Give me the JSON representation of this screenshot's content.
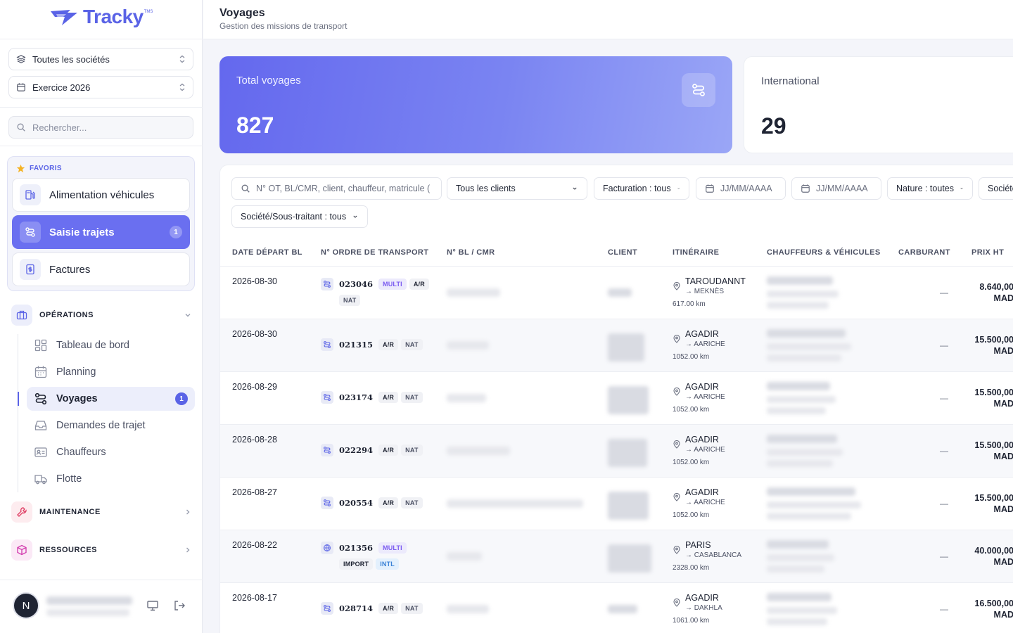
{
  "brand": {
    "name": "Tracky",
    "suffix": "TMS"
  },
  "sidebar": {
    "company_select": "Toutes les sociétés",
    "year_select": "Exercice 2026",
    "search_placeholder": "Rechercher...",
    "favorites": {
      "title": "FAVORIS",
      "items": [
        {
          "label": "Alimentation véhicules"
        },
        {
          "label": "Saisie trajets",
          "badge": "1"
        },
        {
          "label": "Factures"
        }
      ]
    },
    "sections": {
      "operations": "OPÉRATIONS",
      "maintenance": "MAINTENANCE",
      "ressources": "RESSOURCES"
    },
    "nav": [
      {
        "label": "Tableau de bord"
      },
      {
        "label": "Planning"
      },
      {
        "label": "Voyages",
        "badge": "1"
      },
      {
        "label": "Demandes de trajet"
      },
      {
        "label": "Chauffeurs"
      },
      {
        "label": "Flotte"
      }
    ],
    "user_initial": "N"
  },
  "header": {
    "title": "Voyages",
    "subtitle": "Gestion des missions de transport"
  },
  "stats": {
    "total": {
      "label": "Total voyages",
      "value": "827"
    },
    "international": {
      "label": "International",
      "value": "29"
    }
  },
  "filters": {
    "search_placeholder": "N° OT, BL/CMR, client, chauffeur, matricule (",
    "clients": "Tous les clients",
    "facturation": "Facturation : tous",
    "date_from": "JJ/MM/AAAA",
    "date_to": "JJ/MM/AAAA",
    "nature": "Nature : toutes",
    "societe": "Société",
    "sous_traitant": "Société/Sous-traitant : tous"
  },
  "table": {
    "columns": [
      "DATE DÉPART BL",
      "N° ORDRE DE TRANSPORT",
      "N° BL / CMR",
      "CLIENT",
      "ITINÉRAIRE",
      "CHAUFFEURS & VÉHICULES",
      "CARBURANT",
      "PRIX HT"
    ],
    "rows": [
      {
        "date": "2026-08-30",
        "ot": "023046",
        "tags1": [
          "MULTI",
          "A/R"
        ],
        "tags2": [
          "NAT"
        ],
        "from": "TAROUDANNT",
        "to": "→ MEKNÈS",
        "km": "617.00 km",
        "fuel": "—",
        "price": "8.640,00",
        "currency": "MAD"
      },
      {
        "date": "2026-08-30",
        "ot": "021315",
        "tags1": [
          "A/R",
          "NAT"
        ],
        "tags2": [],
        "from": "AGADIR",
        "to": "→ AARICHE",
        "km": "1052.00 km",
        "fuel": "—",
        "price": "15.500,00",
        "currency": "MAD"
      },
      {
        "date": "2026-08-29",
        "ot": "023174",
        "tags1": [
          "A/R",
          "NAT"
        ],
        "tags2": [],
        "from": "AGADIR",
        "to": "→ AARICHE",
        "km": "1052.00 km",
        "fuel": "—",
        "price": "15.500,00",
        "currency": "MAD"
      },
      {
        "date": "2026-08-28",
        "ot": "022294",
        "tags1": [
          "A/R",
          "NAT"
        ],
        "tags2": [],
        "from": "AGADIR",
        "to": "→ AARICHE",
        "km": "1052.00 km",
        "fuel": "—",
        "price": "15.500,00",
        "currency": "MAD"
      },
      {
        "date": "2026-08-27",
        "ot": "020554",
        "tags1": [
          "A/R",
          "NAT"
        ],
        "tags2": [],
        "from": "AGADIR",
        "to": "→ AARICHE",
        "km": "1052.00 km",
        "fuel": "—",
        "price": "15.500,00",
        "currency": "MAD"
      },
      {
        "date": "2026-08-22",
        "ot": "021356",
        "tags1": [
          "MULTI"
        ],
        "tags2": [
          "IMPORT",
          "INTL"
        ],
        "from": "PARIS",
        "to": "→ CASABLANCA",
        "km": "2328.00 km",
        "fuel": "—",
        "price": "40.000,00",
        "currency": "MAD"
      },
      {
        "date": "2026-08-17",
        "ot": "028714",
        "tags1": [
          "A/R",
          "NAT"
        ],
        "tags2": [],
        "from": "AGADIR",
        "to": "→ DAKHLA",
        "km": "1061.00 km",
        "fuel": "—",
        "price": "16.500,00",
        "currency": "MAD"
      }
    ]
  }
}
